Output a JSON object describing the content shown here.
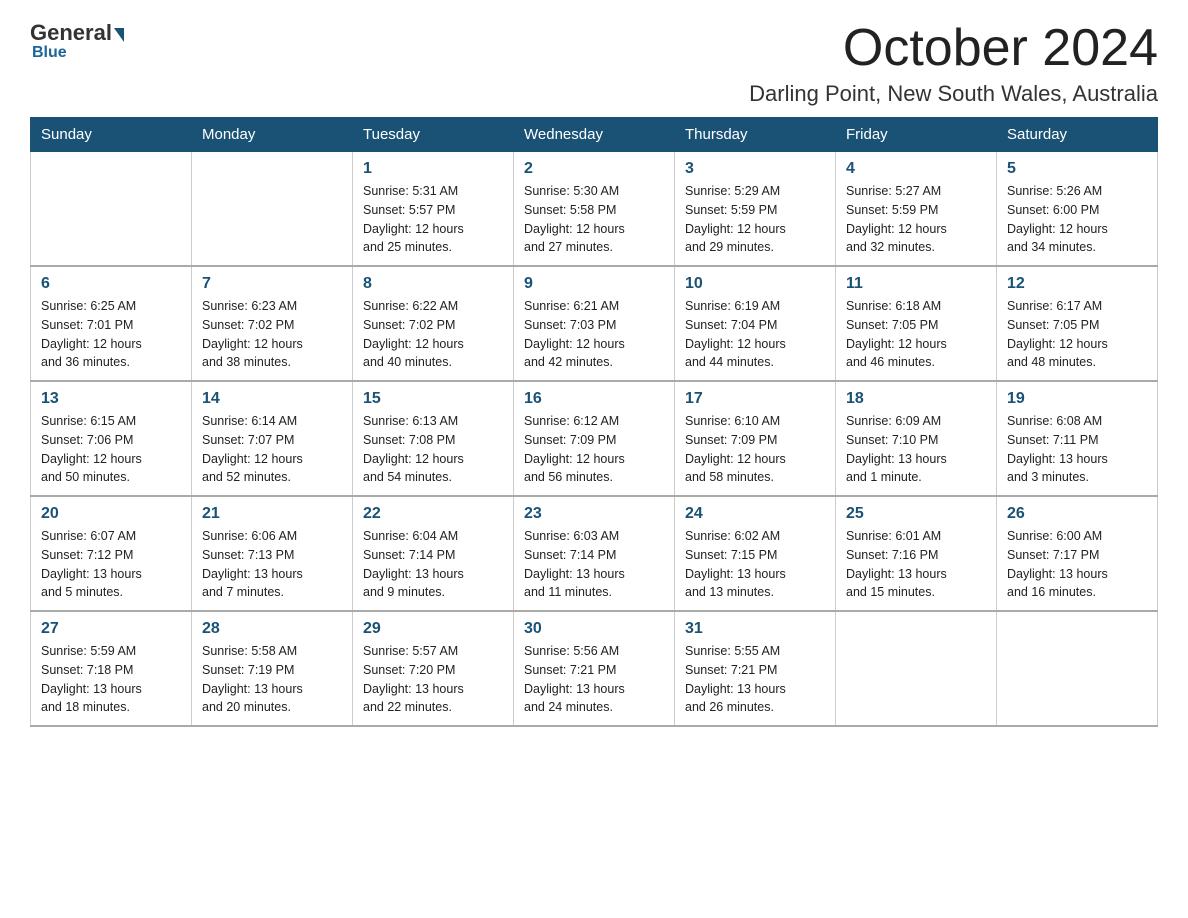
{
  "logo": {
    "general": "General",
    "blue": "Blue",
    "subtitle": "Blue"
  },
  "header": {
    "month_title": "October 2024",
    "location": "Darling Point, New South Wales, Australia"
  },
  "days_of_week": [
    "Sunday",
    "Monday",
    "Tuesday",
    "Wednesday",
    "Thursday",
    "Friday",
    "Saturday"
  ],
  "weeks": [
    [
      {
        "day": "",
        "info": ""
      },
      {
        "day": "",
        "info": ""
      },
      {
        "day": "1",
        "info": "Sunrise: 5:31 AM\nSunset: 5:57 PM\nDaylight: 12 hours\nand 25 minutes."
      },
      {
        "day": "2",
        "info": "Sunrise: 5:30 AM\nSunset: 5:58 PM\nDaylight: 12 hours\nand 27 minutes."
      },
      {
        "day": "3",
        "info": "Sunrise: 5:29 AM\nSunset: 5:59 PM\nDaylight: 12 hours\nand 29 minutes."
      },
      {
        "day": "4",
        "info": "Sunrise: 5:27 AM\nSunset: 5:59 PM\nDaylight: 12 hours\nand 32 minutes."
      },
      {
        "day": "5",
        "info": "Sunrise: 5:26 AM\nSunset: 6:00 PM\nDaylight: 12 hours\nand 34 minutes."
      }
    ],
    [
      {
        "day": "6",
        "info": "Sunrise: 6:25 AM\nSunset: 7:01 PM\nDaylight: 12 hours\nand 36 minutes."
      },
      {
        "day": "7",
        "info": "Sunrise: 6:23 AM\nSunset: 7:02 PM\nDaylight: 12 hours\nand 38 minutes."
      },
      {
        "day": "8",
        "info": "Sunrise: 6:22 AM\nSunset: 7:02 PM\nDaylight: 12 hours\nand 40 minutes."
      },
      {
        "day": "9",
        "info": "Sunrise: 6:21 AM\nSunset: 7:03 PM\nDaylight: 12 hours\nand 42 minutes."
      },
      {
        "day": "10",
        "info": "Sunrise: 6:19 AM\nSunset: 7:04 PM\nDaylight: 12 hours\nand 44 minutes."
      },
      {
        "day": "11",
        "info": "Sunrise: 6:18 AM\nSunset: 7:05 PM\nDaylight: 12 hours\nand 46 minutes."
      },
      {
        "day": "12",
        "info": "Sunrise: 6:17 AM\nSunset: 7:05 PM\nDaylight: 12 hours\nand 48 minutes."
      }
    ],
    [
      {
        "day": "13",
        "info": "Sunrise: 6:15 AM\nSunset: 7:06 PM\nDaylight: 12 hours\nand 50 minutes."
      },
      {
        "day": "14",
        "info": "Sunrise: 6:14 AM\nSunset: 7:07 PM\nDaylight: 12 hours\nand 52 minutes."
      },
      {
        "day": "15",
        "info": "Sunrise: 6:13 AM\nSunset: 7:08 PM\nDaylight: 12 hours\nand 54 minutes."
      },
      {
        "day": "16",
        "info": "Sunrise: 6:12 AM\nSunset: 7:09 PM\nDaylight: 12 hours\nand 56 minutes."
      },
      {
        "day": "17",
        "info": "Sunrise: 6:10 AM\nSunset: 7:09 PM\nDaylight: 12 hours\nand 58 minutes."
      },
      {
        "day": "18",
        "info": "Sunrise: 6:09 AM\nSunset: 7:10 PM\nDaylight: 13 hours\nand 1 minute."
      },
      {
        "day": "19",
        "info": "Sunrise: 6:08 AM\nSunset: 7:11 PM\nDaylight: 13 hours\nand 3 minutes."
      }
    ],
    [
      {
        "day": "20",
        "info": "Sunrise: 6:07 AM\nSunset: 7:12 PM\nDaylight: 13 hours\nand 5 minutes."
      },
      {
        "day": "21",
        "info": "Sunrise: 6:06 AM\nSunset: 7:13 PM\nDaylight: 13 hours\nand 7 minutes."
      },
      {
        "day": "22",
        "info": "Sunrise: 6:04 AM\nSunset: 7:14 PM\nDaylight: 13 hours\nand 9 minutes."
      },
      {
        "day": "23",
        "info": "Sunrise: 6:03 AM\nSunset: 7:14 PM\nDaylight: 13 hours\nand 11 minutes."
      },
      {
        "day": "24",
        "info": "Sunrise: 6:02 AM\nSunset: 7:15 PM\nDaylight: 13 hours\nand 13 minutes."
      },
      {
        "day": "25",
        "info": "Sunrise: 6:01 AM\nSunset: 7:16 PM\nDaylight: 13 hours\nand 15 minutes."
      },
      {
        "day": "26",
        "info": "Sunrise: 6:00 AM\nSunset: 7:17 PM\nDaylight: 13 hours\nand 16 minutes."
      }
    ],
    [
      {
        "day": "27",
        "info": "Sunrise: 5:59 AM\nSunset: 7:18 PM\nDaylight: 13 hours\nand 18 minutes."
      },
      {
        "day": "28",
        "info": "Sunrise: 5:58 AM\nSunset: 7:19 PM\nDaylight: 13 hours\nand 20 minutes."
      },
      {
        "day": "29",
        "info": "Sunrise: 5:57 AM\nSunset: 7:20 PM\nDaylight: 13 hours\nand 22 minutes."
      },
      {
        "day": "30",
        "info": "Sunrise: 5:56 AM\nSunset: 7:21 PM\nDaylight: 13 hours\nand 24 minutes."
      },
      {
        "day": "31",
        "info": "Sunrise: 5:55 AM\nSunset: 7:21 PM\nDaylight: 13 hours\nand 26 minutes."
      },
      {
        "day": "",
        "info": ""
      },
      {
        "day": "",
        "info": ""
      }
    ]
  ]
}
